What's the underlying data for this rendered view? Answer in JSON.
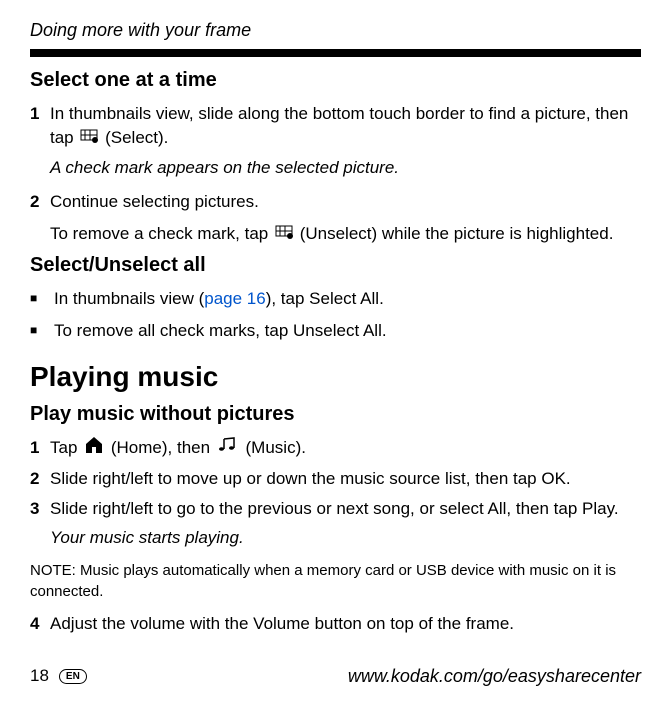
{
  "header": "Doing more with your frame",
  "section1": {
    "title": "Select one at a time",
    "step1_pre": "In thumbnails view, slide along the bottom touch border to find a picture, then tap ",
    "step1_post": " (Select).",
    "result1": "A check mark appears on the selected picture.",
    "step2": "Continue selecting pictures.",
    "remove_pre": "To remove a check mark, tap ",
    "remove_post": " (Unselect) while the picture is highlighted."
  },
  "section2": {
    "title": "Select/Unselect all",
    "bullet1_pre": "In thumbnails view (",
    "bullet1_link": "page 16",
    "bullet1_post": "), tap Select All.",
    "bullet2": "To remove all check marks, tap Unselect All."
  },
  "section3": {
    "title": "Playing music",
    "subtitle": "Play music without pictures",
    "step1_pre": "Tap ",
    "step1_mid": " (Home), then ",
    "step1_post": " (Music).",
    "step2": "Slide right/left to move up or down the music source list, then tap OK.",
    "step3": "Slide right/left to go to the previous or next song, or select All, then tap Play.",
    "result3": "Your music starts playing.",
    "note": "NOTE:  Music plays automatically when a memory card or USB device with music on it is connected.",
    "step4": "Adjust the volume with the Volume button on top of the frame."
  },
  "footer": {
    "page": "18",
    "lang": "EN",
    "url": "www.kodak.com/go/easysharecenter"
  }
}
